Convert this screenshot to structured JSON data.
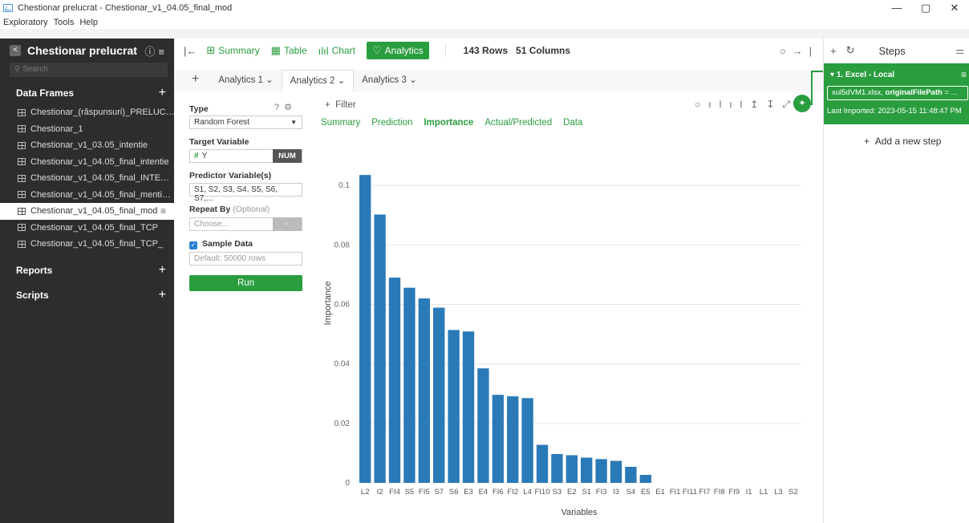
{
  "window": {
    "title": "Chestionar prelucrat - Chestionar_v1_04.05_final_mod",
    "controls": [
      "—",
      "▢",
      "✕"
    ]
  },
  "menu": [
    "Exploratory",
    "Tools",
    "Help"
  ],
  "sidebar": {
    "project_title": "Chestionar prelucrat",
    "search_placeholder": "Search",
    "data_frames_label": "Data Frames",
    "data_frames": [
      "Chestionar_(răspunsuri)_PRELUC…",
      "Chestionar_1",
      "Chestionar_v1_03.05_intentie",
      "Chestionar_v1_04.05_final_intentie",
      "Chestionar_v1_04.05_final_INTE…",
      "Chestionar_v1_04.05_final_menti…",
      "Chestionar_v1_04.05_final_mod",
      "Chestionar_v1_04.05_final_TCP",
      "Chestionar_v1_04.05_final_TCP_"
    ],
    "active_index": 6,
    "reports_label": "Reports",
    "scripts_label": "Scripts"
  },
  "toolbar": {
    "tabs": [
      "Summary",
      "Table",
      "Chart",
      "Analytics"
    ],
    "rows": "143 Rows",
    "columns": "51 Columns"
  },
  "analytics_tabs": [
    "Analytics 1",
    "Analytics 2",
    "Analytics 3"
  ],
  "config": {
    "type_label": "Type",
    "type_value": "Random Forest",
    "target_label": "Target Variable",
    "target_value": "Y",
    "target_badge": "NUM",
    "predictor_label": "Predictor Variable(s)",
    "predictor_value": "S1, S2, S3, S4, S5, S6, S7,...",
    "repeat_label": "Repeat By",
    "repeat_optional": "(Optional)",
    "repeat_placeholder": "Choose...",
    "repeat_button": "-",
    "sample_label": "Sample Data",
    "sample_placeholder": "Default: 50000 rows",
    "run_label": "Run"
  },
  "results": {
    "filter_label": "Filter",
    "subtabs": [
      "Summary",
      "Prediction",
      "Importance",
      "Actual/Predicted",
      "Data"
    ],
    "active_subtab": "Importance"
  },
  "chart_data": {
    "type": "bar",
    "categories": [
      "L2",
      "I2",
      "FI4",
      "S5",
      "FI5",
      "S7",
      "S6",
      "E3",
      "E4",
      "FI6",
      "FI2",
      "L4",
      "FI10",
      "S3",
      "E2",
      "S1",
      "FI3",
      "I3",
      "S4",
      "E5",
      "E1",
      "FI1",
      "FI11",
      "FI7",
      "FI8",
      "FI9",
      "I1",
      "L1",
      "L3",
      "S2"
    ],
    "values": [
      0.1035,
      0.0902,
      0.069,
      0.0656,
      0.062,
      0.0589,
      0.0514,
      0.0509,
      0.0385,
      0.0296,
      0.0291,
      0.0285,
      0.0128,
      0.0097,
      0.0093,
      0.0085,
      0.008,
      0.0074,
      0.0054,
      0.0027,
      0,
      0,
      0,
      0,
      0,
      0,
      0,
      0,
      0,
      0
    ],
    "xlabel": "Variables",
    "ylabel": "Importance",
    "ylim": [
      0,
      0.11
    ],
    "yticks": [
      0,
      0.02,
      0.04,
      0.06,
      0.08,
      0.1
    ],
    "grid": true,
    "bar_color": "#2a7ab8"
  },
  "steps": {
    "title": "Steps",
    "step_name": "1. Excel - Local",
    "step_cmd_prefix": "xul5dVM1.xlsx, ",
    "step_cmd_bold": "originalFilePath",
    "step_cmd_suffix": " = ...",
    "last_imported": "Last Imported: 2023-05-15 11:48:47 PM",
    "add_step": "Add a new step"
  },
  "colors": {
    "accent": "#2a9d3f",
    "sidebar_bg": "#2d2d2d",
    "bar": "#2a7ab8"
  }
}
